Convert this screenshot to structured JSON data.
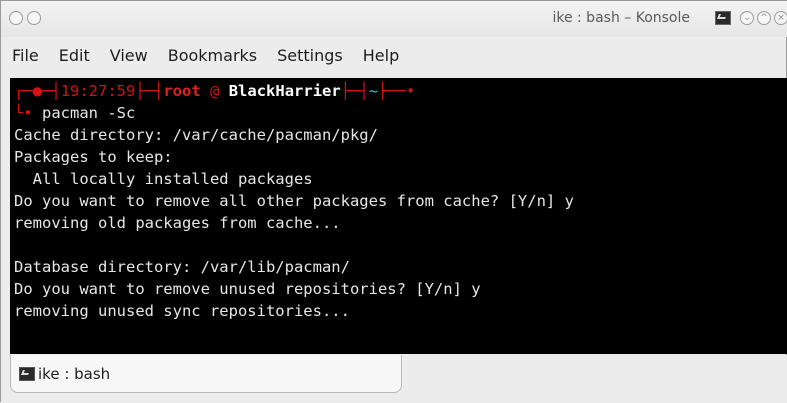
{
  "window": {
    "title": "ike : bash – Konsole",
    "minimize_glyph": "⌄",
    "maximize_glyph": "^",
    "close_glyph": "×"
  },
  "menu": [
    "File",
    "Edit",
    "View",
    "Bookmarks",
    "Settings",
    "Help"
  ],
  "terminal": {
    "prompt": {
      "frame_left": "┌─",
      "dot": "●",
      "sep1": "─┤",
      "time": "19:27:59",
      "sep2": "├─┤",
      "user": "root",
      "at": "@",
      "host": "BlackHarrier",
      "sep3": "├─┤",
      "cwd": "~",
      "frame_right": "├──•",
      "cont": "└•",
      "command": " pacman -Sc"
    },
    "output": [
      "Cache directory: /var/cache/pacman/pkg/",
      "Packages to keep:",
      "  All locally installed packages",
      "Do you want to remove all other packages from cache? [Y/n] y",
      "removing old packages from cache...",
      "",
      "Database directory: /var/lib/pacman/",
      "Do you want to remove unused repositories? [Y/n] y",
      "removing unused sync repositories..."
    ]
  },
  "tabs": [
    {
      "label": "ike : bash"
    }
  ],
  "icons": {
    "app": "konsole-icon",
    "tab": "terminal-icon"
  }
}
